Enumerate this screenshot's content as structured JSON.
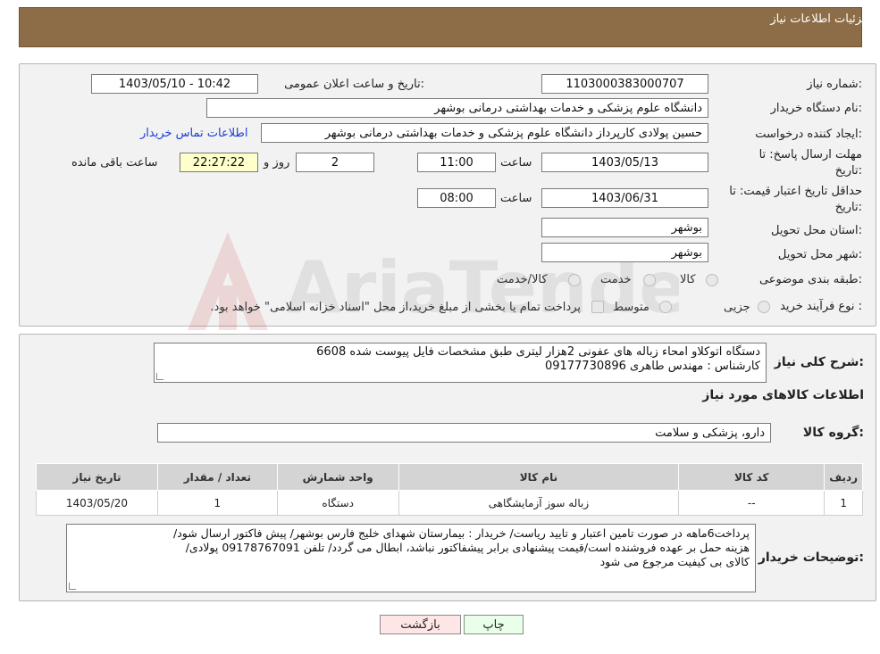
{
  "header": {
    "title": "جزئیات اطلاعات نیاز"
  },
  "form": {
    "need_number": {
      "label": "شماره نیاز:",
      "value": "1103000383000707"
    },
    "announce_datetime": {
      "label": "تاریخ و ساعت اعلان عمومی:",
      "value": "1403/05/10 - 10:42"
    },
    "buyer_org": {
      "label": "نام دستگاه خریدار:",
      "value": "دانشگاه علوم پزشکی و خدمات بهداشتی درمانی بوشهر"
    },
    "requester": {
      "label": "ایجاد کننده درخواست:",
      "value": "حسین پولادی کارپرداز دانشگاه علوم پزشکی و خدمات بهداشتی درمانی بوشهر",
      "contact_link": "اطلاعات تماس خریدار"
    },
    "reply_deadline": {
      "label_line1": "مهلت ارسال پاسخ: تا",
      "label_line2": "تاریخ:",
      "date": "1403/05/13",
      "time_label": "ساعت",
      "time": "11:00",
      "days": "2",
      "days_label": "روز و",
      "remaining": "22:27:22",
      "remaining_label": "ساعت باقی مانده"
    },
    "price_validity": {
      "label_line1": "حداقل تاریخ اعتبار قیمت: تا",
      "label_line2": "تاریخ:",
      "date": "1403/06/31",
      "time_label": "ساعت",
      "time": "08:00"
    },
    "delivery_province": {
      "label": "استان محل تحویل:",
      "value": "بوشهر"
    },
    "delivery_city": {
      "label": "شهر محل تحویل:",
      "value": "بوشهر"
    },
    "category": {
      "label": "طبقه بندی موضوعی:",
      "options": [
        "کالا",
        "خدمت",
        "کالا/خدمت"
      ]
    },
    "purchase_type": {
      "label": "نوع فرآیند خرید :",
      "options": [
        "جزیی",
        "متوسط"
      ],
      "note": "پرداخت تمام یا بخشی از مبلغ خرید،از محل \"اسناد خزانه اسلامی\" خواهد بود."
    }
  },
  "description": {
    "label": "شرح کلی نیاز:",
    "line1": "دستگاه اتوکلاو امحاء زباله های عفونی 2هزار لیتری طبق مشخصات فایل پیوست شده 6608",
    "line2": "کارشناس : مهندس طاهری 09177730896"
  },
  "goods": {
    "section_title": "اطلاعات کالاهای مورد نیاز",
    "group_label": "گروه کالا:",
    "group_value": "دارو، پزشکی و سلامت",
    "table": {
      "headers": [
        "ردیف",
        "کد کالا",
        "نام کالا",
        "واحد شمارش",
        "تعداد / مقدار",
        "تاریخ نیاز"
      ],
      "rows": [
        [
          "1",
          "--",
          "زباله سوز آزمایشگاهی",
          "دستگاه",
          "1",
          "1403/05/20"
        ]
      ]
    }
  },
  "buyer_notes": {
    "label": "توضیحات خریدار:",
    "line1": "پرداخت6ماهه در صورت تامین اعتبار و تایید ریاست/ خریدار : بیمارستان شهدای خلیج فارس بوشهر/ پیش فاکتور ارسال شود/",
    "line2": "هزینه حمل بر عهده فروشنده است/قیمت پیشنهادی برابر پیشفاکتور نباشد، ابطال می گردد/ تلفن 09178767091 پولادی/",
    "line3": "کالای بی کیفیت مرجوع می شود"
  },
  "buttons": {
    "print": "چاپ",
    "back": "بازگشت"
  },
  "watermark": {
    "text": "AriaTender.neT"
  },
  "colors": {
    "header_bg": "#8c6d47",
    "link": "#1a3ed8",
    "remaining_bg": "#ffffcc"
  }
}
